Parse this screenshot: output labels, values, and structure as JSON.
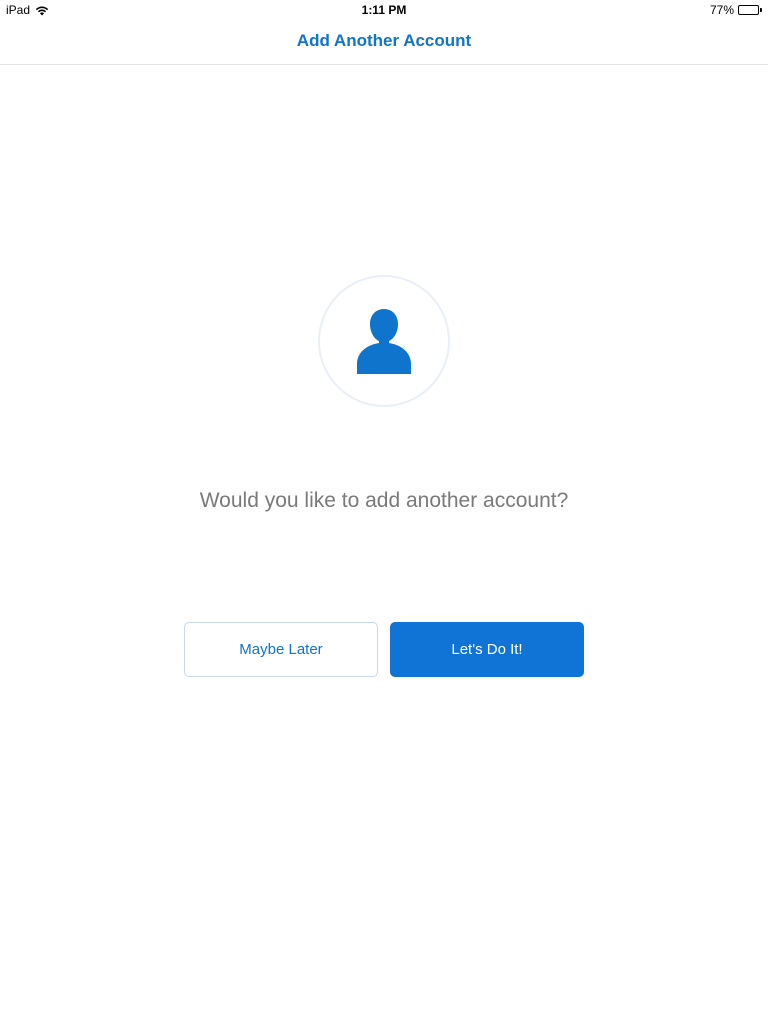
{
  "status_bar": {
    "device": "iPad",
    "time": "1:11 PM",
    "battery_percent": "77%",
    "battery_level": 0.77,
    "wifi_icon": "wifi-icon",
    "battery_icon": "battery-icon"
  },
  "nav": {
    "title": "Add Another Account"
  },
  "main": {
    "avatar_icon": "person-icon",
    "prompt": "Would you like to add another account?",
    "secondary_button_label": "Maybe Later",
    "primary_button_label": "Let's Do It!"
  },
  "colors": {
    "accent": "#0f74cc",
    "primary_button": "#0f74d6",
    "prompt_text": "#7a7a7a"
  }
}
